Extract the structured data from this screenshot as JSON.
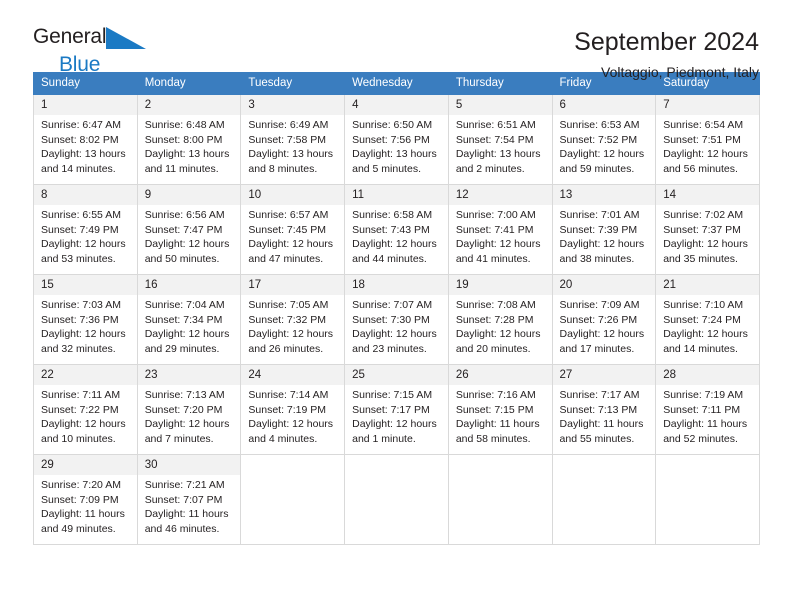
{
  "brand": {
    "name_part1": "General",
    "name_part2": "Blue",
    "logo_icon": "triangle-flag-icon",
    "color_primary": "#231f20",
    "color_accent": "#1b7ac4"
  },
  "header": {
    "title": "September 2024",
    "subtitle": "Voltaggio, Piedmont, Italy"
  },
  "calendar": {
    "header_bg": "#3a7dbf",
    "header_text_color": "#ffffff",
    "daynum_bg": "#f2f2f2",
    "grid_color": "#d9d9d9",
    "weekday_headers": [
      "Sunday",
      "Monday",
      "Tuesday",
      "Wednesday",
      "Thursday",
      "Friday",
      "Saturday"
    ],
    "weeks": [
      [
        {
          "day": "1",
          "sunrise": "Sunrise: 6:47 AM",
          "sunset": "Sunset: 8:02 PM",
          "daylight1": "Daylight: 13 hours",
          "daylight2": "and 14 minutes."
        },
        {
          "day": "2",
          "sunrise": "Sunrise: 6:48 AM",
          "sunset": "Sunset: 8:00 PM",
          "daylight1": "Daylight: 13 hours",
          "daylight2": "and 11 minutes."
        },
        {
          "day": "3",
          "sunrise": "Sunrise: 6:49 AM",
          "sunset": "Sunset: 7:58 PM",
          "daylight1": "Daylight: 13 hours",
          "daylight2": "and 8 minutes."
        },
        {
          "day": "4",
          "sunrise": "Sunrise: 6:50 AM",
          "sunset": "Sunset: 7:56 PM",
          "daylight1": "Daylight: 13 hours",
          "daylight2": "and 5 minutes."
        },
        {
          "day": "5",
          "sunrise": "Sunrise: 6:51 AM",
          "sunset": "Sunset: 7:54 PM",
          "daylight1": "Daylight: 13 hours",
          "daylight2": "and 2 minutes."
        },
        {
          "day": "6",
          "sunrise": "Sunrise: 6:53 AM",
          "sunset": "Sunset: 7:52 PM",
          "daylight1": "Daylight: 12 hours",
          "daylight2": "and 59 minutes."
        },
        {
          "day": "7",
          "sunrise": "Sunrise: 6:54 AM",
          "sunset": "Sunset: 7:51 PM",
          "daylight1": "Daylight: 12 hours",
          "daylight2": "and 56 minutes."
        }
      ],
      [
        {
          "day": "8",
          "sunrise": "Sunrise: 6:55 AM",
          "sunset": "Sunset: 7:49 PM",
          "daylight1": "Daylight: 12 hours",
          "daylight2": "and 53 minutes."
        },
        {
          "day": "9",
          "sunrise": "Sunrise: 6:56 AM",
          "sunset": "Sunset: 7:47 PM",
          "daylight1": "Daylight: 12 hours",
          "daylight2": "and 50 minutes."
        },
        {
          "day": "10",
          "sunrise": "Sunrise: 6:57 AM",
          "sunset": "Sunset: 7:45 PM",
          "daylight1": "Daylight: 12 hours",
          "daylight2": "and 47 minutes."
        },
        {
          "day": "11",
          "sunrise": "Sunrise: 6:58 AM",
          "sunset": "Sunset: 7:43 PM",
          "daylight1": "Daylight: 12 hours",
          "daylight2": "and 44 minutes."
        },
        {
          "day": "12",
          "sunrise": "Sunrise: 7:00 AM",
          "sunset": "Sunset: 7:41 PM",
          "daylight1": "Daylight: 12 hours",
          "daylight2": "and 41 minutes."
        },
        {
          "day": "13",
          "sunrise": "Sunrise: 7:01 AM",
          "sunset": "Sunset: 7:39 PM",
          "daylight1": "Daylight: 12 hours",
          "daylight2": "and 38 minutes."
        },
        {
          "day": "14",
          "sunrise": "Sunrise: 7:02 AM",
          "sunset": "Sunset: 7:37 PM",
          "daylight1": "Daylight: 12 hours",
          "daylight2": "and 35 minutes."
        }
      ],
      [
        {
          "day": "15",
          "sunrise": "Sunrise: 7:03 AM",
          "sunset": "Sunset: 7:36 PM",
          "daylight1": "Daylight: 12 hours",
          "daylight2": "and 32 minutes."
        },
        {
          "day": "16",
          "sunrise": "Sunrise: 7:04 AM",
          "sunset": "Sunset: 7:34 PM",
          "daylight1": "Daylight: 12 hours",
          "daylight2": "and 29 minutes."
        },
        {
          "day": "17",
          "sunrise": "Sunrise: 7:05 AM",
          "sunset": "Sunset: 7:32 PM",
          "daylight1": "Daylight: 12 hours",
          "daylight2": "and 26 minutes."
        },
        {
          "day": "18",
          "sunrise": "Sunrise: 7:07 AM",
          "sunset": "Sunset: 7:30 PM",
          "daylight1": "Daylight: 12 hours",
          "daylight2": "and 23 minutes."
        },
        {
          "day": "19",
          "sunrise": "Sunrise: 7:08 AM",
          "sunset": "Sunset: 7:28 PM",
          "daylight1": "Daylight: 12 hours",
          "daylight2": "and 20 minutes."
        },
        {
          "day": "20",
          "sunrise": "Sunrise: 7:09 AM",
          "sunset": "Sunset: 7:26 PM",
          "daylight1": "Daylight: 12 hours",
          "daylight2": "and 17 minutes."
        },
        {
          "day": "21",
          "sunrise": "Sunrise: 7:10 AM",
          "sunset": "Sunset: 7:24 PM",
          "daylight1": "Daylight: 12 hours",
          "daylight2": "and 14 minutes."
        }
      ],
      [
        {
          "day": "22",
          "sunrise": "Sunrise: 7:11 AM",
          "sunset": "Sunset: 7:22 PM",
          "daylight1": "Daylight: 12 hours",
          "daylight2": "and 10 minutes."
        },
        {
          "day": "23",
          "sunrise": "Sunrise: 7:13 AM",
          "sunset": "Sunset: 7:20 PM",
          "daylight1": "Daylight: 12 hours",
          "daylight2": "and 7 minutes."
        },
        {
          "day": "24",
          "sunrise": "Sunrise: 7:14 AM",
          "sunset": "Sunset: 7:19 PM",
          "daylight1": "Daylight: 12 hours",
          "daylight2": "and 4 minutes."
        },
        {
          "day": "25",
          "sunrise": "Sunrise: 7:15 AM",
          "sunset": "Sunset: 7:17 PM",
          "daylight1": "Daylight: 12 hours",
          "daylight2": "and 1 minute."
        },
        {
          "day": "26",
          "sunrise": "Sunrise: 7:16 AM",
          "sunset": "Sunset: 7:15 PM",
          "daylight1": "Daylight: 11 hours",
          "daylight2": "and 58 minutes."
        },
        {
          "day": "27",
          "sunrise": "Sunrise: 7:17 AM",
          "sunset": "Sunset: 7:13 PM",
          "daylight1": "Daylight: 11 hours",
          "daylight2": "and 55 minutes."
        },
        {
          "day": "28",
          "sunrise": "Sunrise: 7:19 AM",
          "sunset": "Sunset: 7:11 PM",
          "daylight1": "Daylight: 11 hours",
          "daylight2": "and 52 minutes."
        }
      ],
      [
        {
          "day": "29",
          "sunrise": "Sunrise: 7:20 AM",
          "sunset": "Sunset: 7:09 PM",
          "daylight1": "Daylight: 11 hours",
          "daylight2": "and 49 minutes."
        },
        {
          "day": "30",
          "sunrise": "Sunrise: 7:21 AM",
          "sunset": "Sunset: 7:07 PM",
          "daylight1": "Daylight: 11 hours",
          "daylight2": "and 46 minutes."
        },
        {
          "day": "",
          "sunrise": "",
          "sunset": "",
          "daylight1": "",
          "daylight2": ""
        },
        {
          "day": "",
          "sunrise": "",
          "sunset": "",
          "daylight1": "",
          "daylight2": ""
        },
        {
          "day": "",
          "sunrise": "",
          "sunset": "",
          "daylight1": "",
          "daylight2": ""
        },
        {
          "day": "",
          "sunrise": "",
          "sunset": "",
          "daylight1": "",
          "daylight2": ""
        },
        {
          "day": "",
          "sunrise": "",
          "sunset": "",
          "daylight1": "",
          "daylight2": ""
        }
      ]
    ]
  }
}
